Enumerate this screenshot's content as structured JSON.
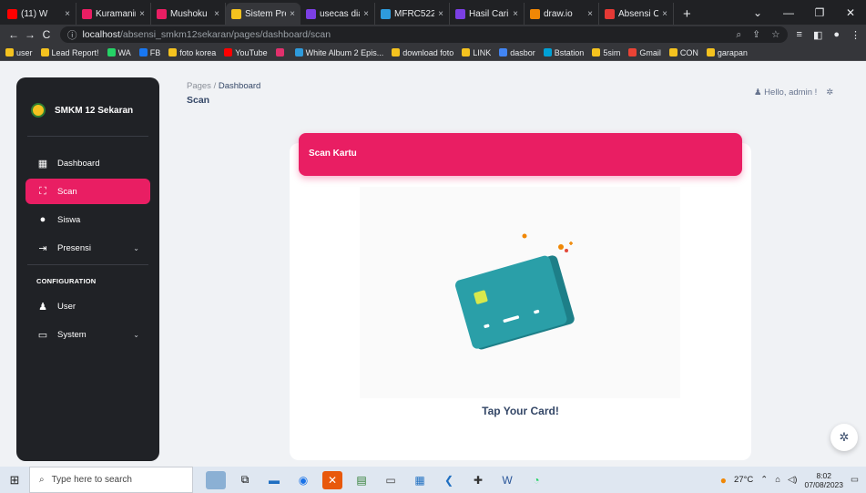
{
  "browser": {
    "tabs": [
      {
        "label": "(11) W",
        "color": "#ff0000",
        "close": "×"
      },
      {
        "label": "Kuramanin",
        "color": "#e91e63",
        "close": "×"
      },
      {
        "label": "Mushoku",
        "color": "#e91e63",
        "close": "×"
      },
      {
        "label": "Sistem Pre",
        "color": "#f4c21f",
        "close": "×",
        "active": true
      },
      {
        "label": "usecas dia",
        "color": "#7b3fe4",
        "close": "×"
      },
      {
        "label": "MFRC522",
        "color": "#2e9bdc",
        "close": "×"
      },
      {
        "label": "Hasil Cari",
        "color": "#7b3fe4",
        "close": "×"
      },
      {
        "label": "draw.io",
        "color": "#f08705",
        "close": "×"
      },
      {
        "label": "Absensi O",
        "color": "#e53935",
        "close": "×"
      }
    ],
    "new_tab": "+",
    "window_controls": [
      "⌄",
      "—",
      "❐",
      "✕"
    ],
    "url_host": "localhost",
    "url_path": "/absensi_smkm12sekaran/pages/dashboard/scan",
    "bookmarks": [
      {
        "label": "user",
        "color": "#f4c21f"
      },
      {
        "label": "Lead Report!",
        "color": "#f4c21f"
      },
      {
        "label": "WA",
        "color": "#25d366"
      },
      {
        "label": "FB",
        "color": "#1877f2"
      },
      {
        "label": "foto korea",
        "color": "#f4c21f"
      },
      {
        "label": "YouTube",
        "color": "#ff0000"
      },
      {
        "label": "",
        "color": "#e1306c"
      },
      {
        "label": "White Album 2 Epis...",
        "color": "#2e9bdc"
      },
      {
        "label": "download foto",
        "color": "#f4c21f"
      },
      {
        "label": "LINK",
        "color": "#f4c21f"
      },
      {
        "label": "dasbor",
        "color": "#4285f4"
      },
      {
        "label": "Bstation",
        "color": "#00a1d6"
      },
      {
        "label": "5sim",
        "color": "#f4c21f"
      },
      {
        "label": "Gmail",
        "color": "#ea4335"
      },
      {
        "label": "CON",
        "color": "#f4c21f"
      },
      {
        "label": "garapan",
        "color": "#f4c21f"
      }
    ]
  },
  "sidebar": {
    "brand": "SMKM 12 Sekaran",
    "items": [
      {
        "label": "Dashboard",
        "icon": "dashboard-icon"
      },
      {
        "label": "Scan",
        "icon": "scan-icon",
        "active": true
      },
      {
        "label": "Siswa",
        "icon": "person-icon"
      },
      {
        "label": "Presensi",
        "icon": "login-icon",
        "chevron": "⌄"
      }
    ],
    "section": "CONFIGURATION",
    "config_items": [
      {
        "label": "User",
        "icon": "users-icon"
      },
      {
        "label": "System",
        "icon": "monitor-icon",
        "chevron": "⌄"
      }
    ]
  },
  "header": {
    "breadcrumb_root": "Pages",
    "breadcrumb_sep": "/",
    "breadcrumb_current": "Dashboard",
    "title": "Scan",
    "greeting": "Hello, admin !"
  },
  "main": {
    "card_title": "Scan Kartu",
    "prompt": "Tap Your Card!"
  },
  "taskbar": {
    "search_placeholder": "Type here to search",
    "weather": "27°C",
    "time": "8:02",
    "date": "07/08/2023"
  },
  "colors": {
    "accent": "#e91e63",
    "sidebar_bg": "#202226",
    "card_teal": "#2a9fa8"
  }
}
